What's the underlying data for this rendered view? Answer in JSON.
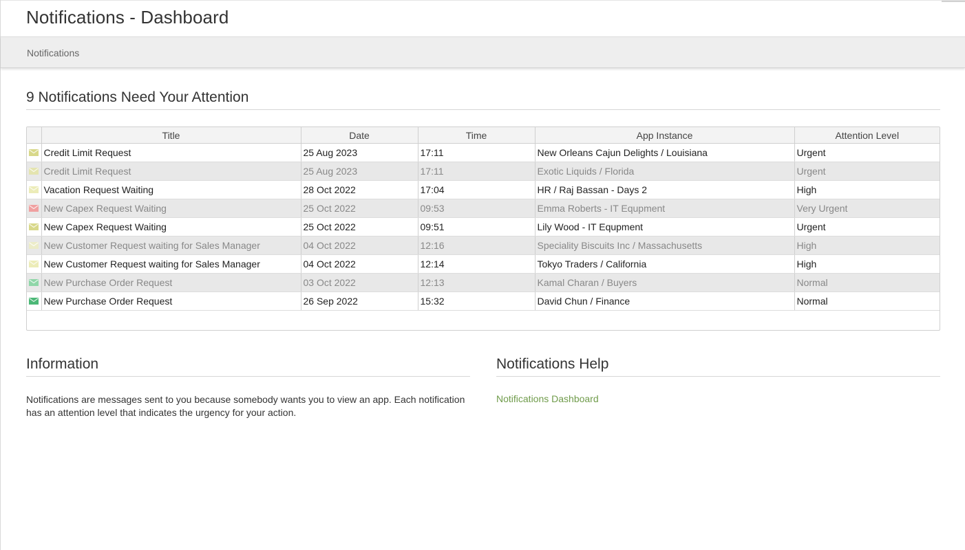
{
  "header": {
    "title": "Notifications - Dashboard"
  },
  "breadcrumb": {
    "item": "Notifications"
  },
  "attention": {
    "heading": "9 Notifications Need Your Attention"
  },
  "table": {
    "columns": [
      "Title",
      "Date",
      "Time",
      "App Instance",
      "Attention Level"
    ],
    "rows": [
      {
        "title": "Credit Limit Request",
        "date": "25 Aug 2023",
        "time": "17:11",
        "instance": "New Orleans Cajun Delights / Louisiana",
        "level": "Urgent",
        "icon_color": "#d8d88a",
        "icon": "envelope-icon"
      },
      {
        "title": "Credit Limit Request",
        "date": "25 Aug 2023",
        "time": "17:11",
        "instance": "Exotic Liquids / Florida",
        "level": "Urgent",
        "icon_color": "#e4e4b0",
        "icon": "envelope-icon"
      },
      {
        "title": "Vacation Request Waiting",
        "date": "28 Oct 2022",
        "time": "17:04",
        "instance": "HR / Raj Bassan - Days 2",
        "level": "High",
        "icon_color": "#ececb8",
        "icon": "envelope-icon"
      },
      {
        "title": "New Capex Request Waiting",
        "date": "25 Oct 2022",
        "time": "09:53",
        "instance": "Emma Roberts - IT Equpment",
        "level": "Very Urgent",
        "icon_color": "#f0a0a0",
        "icon": "envelope-icon"
      },
      {
        "title": "New Capex Request Waiting",
        "date": "25 Oct 2022",
        "time": "09:51",
        "instance": "Lily Wood - IT Equpment",
        "level": "Urgent",
        "icon_color": "#d8d88a",
        "icon": "envelope-icon"
      },
      {
        "title": "New Customer Request waiting for Sales Manager",
        "date": "04 Oct 2022",
        "time": "12:16",
        "instance": "Speciality Biscuits Inc / Massachusetts",
        "level": "High",
        "icon_color": "#ececc8",
        "icon": "envelope-icon"
      },
      {
        "title": "New Customer Request waiting for Sales Manager",
        "date": "04 Oct 2022",
        "time": "12:14",
        "instance": "Tokyo Traders / California",
        "level": "High",
        "icon_color": "#ececb8",
        "icon": "envelope-icon"
      },
      {
        "title": "New Purchase Order Request",
        "date": "03 Oct 2022",
        "time": "12:13",
        "instance": "Kamal Charan / Buyers",
        "level": "Normal",
        "icon_color": "#8fd6a8",
        "icon": "envelope-icon"
      },
      {
        "title": "New Purchase Order Request",
        "date": "26 Sep 2022",
        "time": "15:32",
        "instance": "David Chun / Finance",
        "level": "Normal",
        "icon_color": "#4cb877",
        "icon": "envelope-icon"
      }
    ]
  },
  "information": {
    "heading": "Information",
    "text": "Notifications are messages sent to you because somebody wants you to view an app. Each notification has an attention level that indicates the urgency for your action."
  },
  "help": {
    "heading": "Notifications Help",
    "link": "Notifications Dashboard"
  }
}
